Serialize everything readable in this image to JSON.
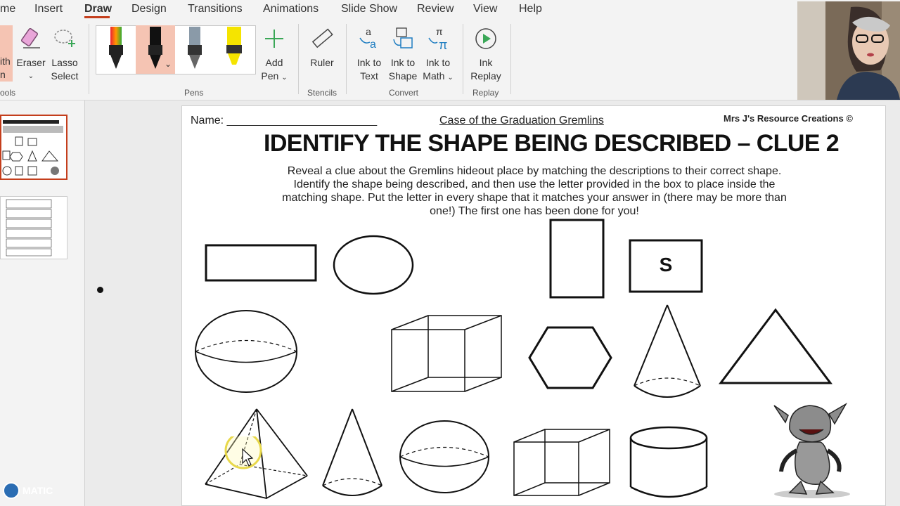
{
  "menu": {
    "tabs": [
      "me",
      "Insert",
      "Draw",
      "Design",
      "Transitions",
      "Animations",
      "Slide Show",
      "Review",
      "View",
      "Help"
    ],
    "active": "Draw"
  },
  "ribbon": {
    "partial_tool_line1": "ith",
    "partial_tool_line2": "n",
    "eraser": "Eraser",
    "lasso_line1": "Lasso",
    "lasso_line2": "Select",
    "tools_group": "ools",
    "add_pen_line1": "Add",
    "add_pen_line2": "Pen",
    "pens_group": "Pens",
    "ruler": "Ruler",
    "stencils_group": "Stencils",
    "ink_text_line1": "Ink to",
    "ink_text_line2": "Text",
    "ink_shape_line1": "Ink to",
    "ink_shape_line2": "Shape",
    "ink_math_line1": "Ink to",
    "ink_math_line2": "Math",
    "convert_group": "Convert",
    "ink_replay_line1": "Ink",
    "ink_replay_line2": "Replay",
    "replay_group": "Replay"
  },
  "slide": {
    "name_label": "Name: ________________________",
    "subtitle": "Case of the Graduation Gremlins",
    "credit": "Mrs J's Resource Creations ©",
    "title": "IDENTIFY THE SHAPE BEING DESCRIBED – CLUE 2",
    "instructions": [
      "Reveal a clue about the Gremlins hideout place by matching the descriptions to their correct shape.",
      "Identify the shape being described, and then use the letter provided in the box to place inside the",
      "matching shape. Put the letter in every shape that it matches your answer in (there may be more than",
      "one!) The first one has been done for you!"
    ],
    "square_letter": "S"
  },
  "watermark": "MATIC",
  "colors": {
    "accent": "#c43e1c",
    "ribbon": "#f3f3f3",
    "slide": "#ffffff"
  }
}
